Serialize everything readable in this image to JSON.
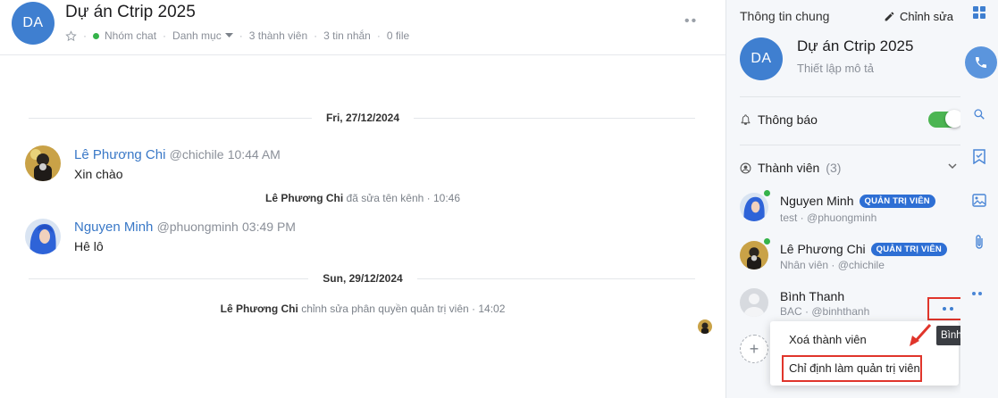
{
  "header": {
    "avatar_initials": "DA",
    "title": "Dự án Ctrip 2025",
    "type_label": "Nhóm chat",
    "category_label": "Danh mục",
    "member_count": "3 thành viên",
    "message_count": "3 tin nhắn",
    "file_count": "0 file"
  },
  "chat": {
    "date_1": "Fri, 27/12/2024",
    "date_2": "Sun, 29/12/2024",
    "messages": [
      {
        "name": "Lê Phương Chi",
        "handle": "@chichile",
        "time": "10:44 AM",
        "text": "Xin chào"
      },
      {
        "name": "Nguyen Minh",
        "handle": "@phuongminh",
        "time": "03:49 PM",
        "text": "Hê lô"
      }
    ],
    "system_1": {
      "actor": "Lê Phương Chi",
      "action": "đã sửa tên kênh · 10:46"
    },
    "system_2": {
      "actor": "Lê Phương Chi",
      "action": "chỉnh sửa phân quyền quản trị viên · 14:02"
    }
  },
  "panel": {
    "title": "Thông tin chung",
    "edit_label": "Chỉnh sửa",
    "avatar_initials": "DA",
    "name": "Dự án Ctrip 2025",
    "description_placeholder": "Thiết lập mô tả",
    "notify_label": "Thông báo",
    "notify_on": true,
    "members_label": "Thành viên",
    "members_count": "(3)",
    "members": [
      {
        "name": "Nguyen Minh",
        "badge": "QUẢN TRỊ VIÊN",
        "sub": "test · @phuongminh",
        "online": true
      },
      {
        "name": "Lê Phương Chi",
        "badge": "QUẢN TRỊ VIÊN",
        "sub": "Nhân viên · @chichile",
        "online": true
      },
      {
        "name": "Bình Thanh",
        "sub": "BAC · @binhthanh",
        "online": false
      }
    ]
  },
  "context_menu": {
    "remove_member": "Xoá thành viên",
    "make_admin": "Chỉ định làm quản trị viên"
  },
  "tooltip": "Bình Thanh",
  "colors": {
    "accent": "#3f7fd0",
    "badge": "#2e6fd4",
    "online": "#35b34a",
    "highlight_box": "#e0352b"
  }
}
